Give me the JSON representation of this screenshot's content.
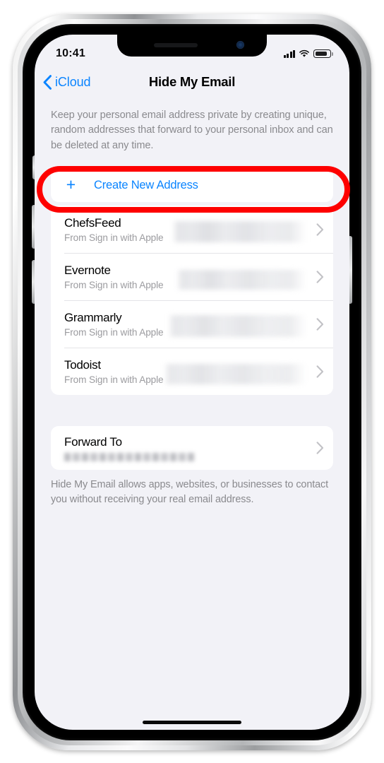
{
  "status_bar": {
    "time": "10:41",
    "cellular_icon": "signal-bars-icon",
    "wifi_icon": "wifi-icon",
    "battery_icon": "battery-icon"
  },
  "nav": {
    "back_label": "iCloud",
    "back_icon": "chevron-left-icon",
    "title": "Hide My Email"
  },
  "intro_text": "Keep your personal email address private by creating unique, random addresses that forward to your personal inbox and can be deleted at any time.",
  "create_row": {
    "plus_icon": "+",
    "label": "Create New Address"
  },
  "apps": [
    {
      "name": "ChefsFeed",
      "subtitle": "From Sign in with Apple",
      "email": "",
      "chevron_icon": "chevron-right-icon"
    },
    {
      "name": "Evernote",
      "subtitle": "From Sign in with Apple",
      "email": "",
      "chevron_icon": "chevron-right-icon"
    },
    {
      "name": "Grammarly",
      "subtitle": "From Sign in with Apple",
      "email": "",
      "chevron_icon": "chevron-right-icon"
    },
    {
      "name": "Todoist",
      "subtitle": "From Sign in with Apple",
      "email": "",
      "chevron_icon": "chevron-right-icon"
    }
  ],
  "forward": {
    "title": "Forward To",
    "email": "",
    "chevron_icon": "chevron-right-icon"
  },
  "footnote": "Hide My Email allows apps, websites, or businesses to contact you without receiving your real email address.",
  "annotation": {
    "shape": "oval-highlight",
    "color": "#fe0000",
    "targets": "create-new-address-row"
  },
  "colors": {
    "accent_blue": "#0a84ff",
    "background": "#f2f2f7",
    "card": "#ffffff",
    "secondary_text": "#8a8a8e",
    "annotation_red": "#fe0000"
  }
}
